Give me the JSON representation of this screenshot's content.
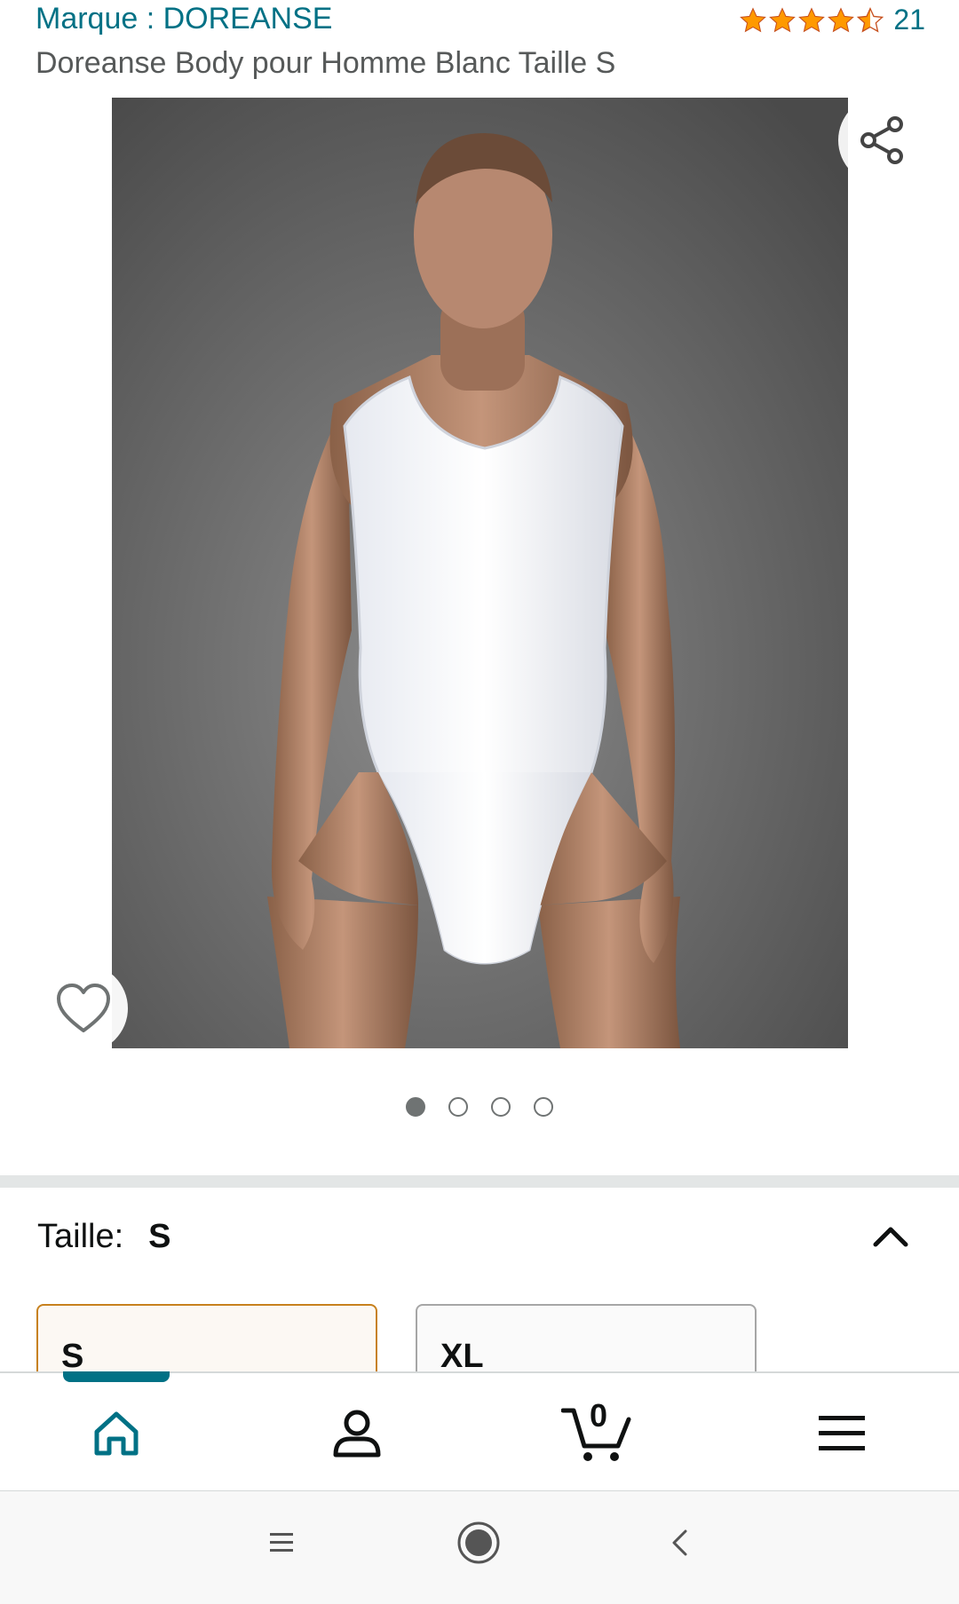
{
  "header": {
    "brand": "Marque : DOREANSE",
    "rating_count": "21",
    "rating_stars": 4.5,
    "product_title": "Doreanse Body pour Homme Blanc Taille S"
  },
  "gallery": {
    "image_count": 4,
    "active_index": 0
  },
  "size_selector": {
    "label": "Taille:",
    "value": "S",
    "options": [
      "S",
      "XL"
    ]
  },
  "bottom_nav": {
    "cart_count": "0",
    "items": [
      "home-icon",
      "account-icon",
      "cart-icon",
      "menu-icon"
    ]
  },
  "colors": {
    "link": "#007185",
    "star": "#ff9900",
    "selected_border": "#c7811e"
  }
}
